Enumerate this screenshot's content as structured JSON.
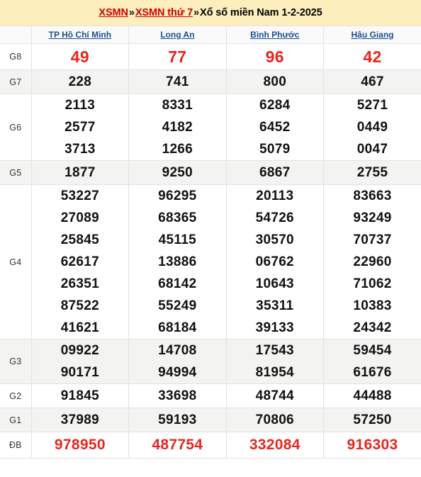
{
  "breadcrumb": {
    "link1": "XSMN",
    "sep1": "»",
    "link2": "XSMN thứ 7",
    "sep2": "»",
    "title": "Xổ số miền Nam 1-2-2025"
  },
  "colors": {
    "banner_bg": "#fdeebd",
    "crumb_link": "#cc0000",
    "province_link": "#1a4d8f",
    "highlight_number": "#e8251f",
    "normal_number": "#111111",
    "shaded_row": "#f3f3f1",
    "border": "#e2e2e2"
  },
  "table": {
    "corner_label": "",
    "provinces": [
      "TP Hồ Chí Minh",
      "Long An",
      "Bình Phước",
      "Hậu Giang"
    ],
    "rows": [
      {
        "prize": "G8",
        "values": [
          [
            "49"
          ],
          [
            "77"
          ],
          [
            "96"
          ],
          [
            "42"
          ]
        ]
      },
      {
        "prize": "G7",
        "values": [
          [
            "228"
          ],
          [
            "741"
          ],
          [
            "800"
          ],
          [
            "467"
          ]
        ]
      },
      {
        "prize": "G6",
        "values": [
          [
            "2113",
            "2577",
            "3713"
          ],
          [
            "8331",
            "4182",
            "1266"
          ],
          [
            "6284",
            "6452",
            "5079"
          ],
          [
            "5271",
            "0449",
            "0047"
          ]
        ]
      },
      {
        "prize": "G5",
        "values": [
          [
            "1877"
          ],
          [
            "9250"
          ],
          [
            "6867"
          ],
          [
            "2755"
          ]
        ]
      },
      {
        "prize": "G4",
        "values": [
          [
            "53227",
            "27089",
            "25845",
            "62617",
            "26351",
            "87522",
            "41621"
          ],
          [
            "96295",
            "68365",
            "45115",
            "13886",
            "68142",
            "55249",
            "68184"
          ],
          [
            "20113",
            "54726",
            "30570",
            "06762",
            "10643",
            "35311",
            "39133"
          ],
          [
            "83663",
            "93249",
            "70737",
            "22960",
            "71062",
            "10383",
            "24342"
          ]
        ]
      },
      {
        "prize": "G3",
        "values": [
          [
            "09922",
            "90171"
          ],
          [
            "14708",
            "94994"
          ],
          [
            "17543",
            "81954"
          ],
          [
            "59454",
            "61676"
          ]
        ]
      },
      {
        "prize": "G2",
        "values": [
          [
            "91845"
          ],
          [
            "33698"
          ],
          [
            "48744"
          ],
          [
            "44488"
          ]
        ]
      },
      {
        "prize": "G1",
        "values": [
          [
            "37989"
          ],
          [
            "59193"
          ],
          [
            "70806"
          ],
          [
            "57250"
          ]
        ]
      },
      {
        "prize": "ĐB",
        "values": [
          [
            "978950"
          ],
          [
            "487754"
          ],
          [
            "332084"
          ],
          [
            "916303"
          ]
        ]
      }
    ]
  }
}
